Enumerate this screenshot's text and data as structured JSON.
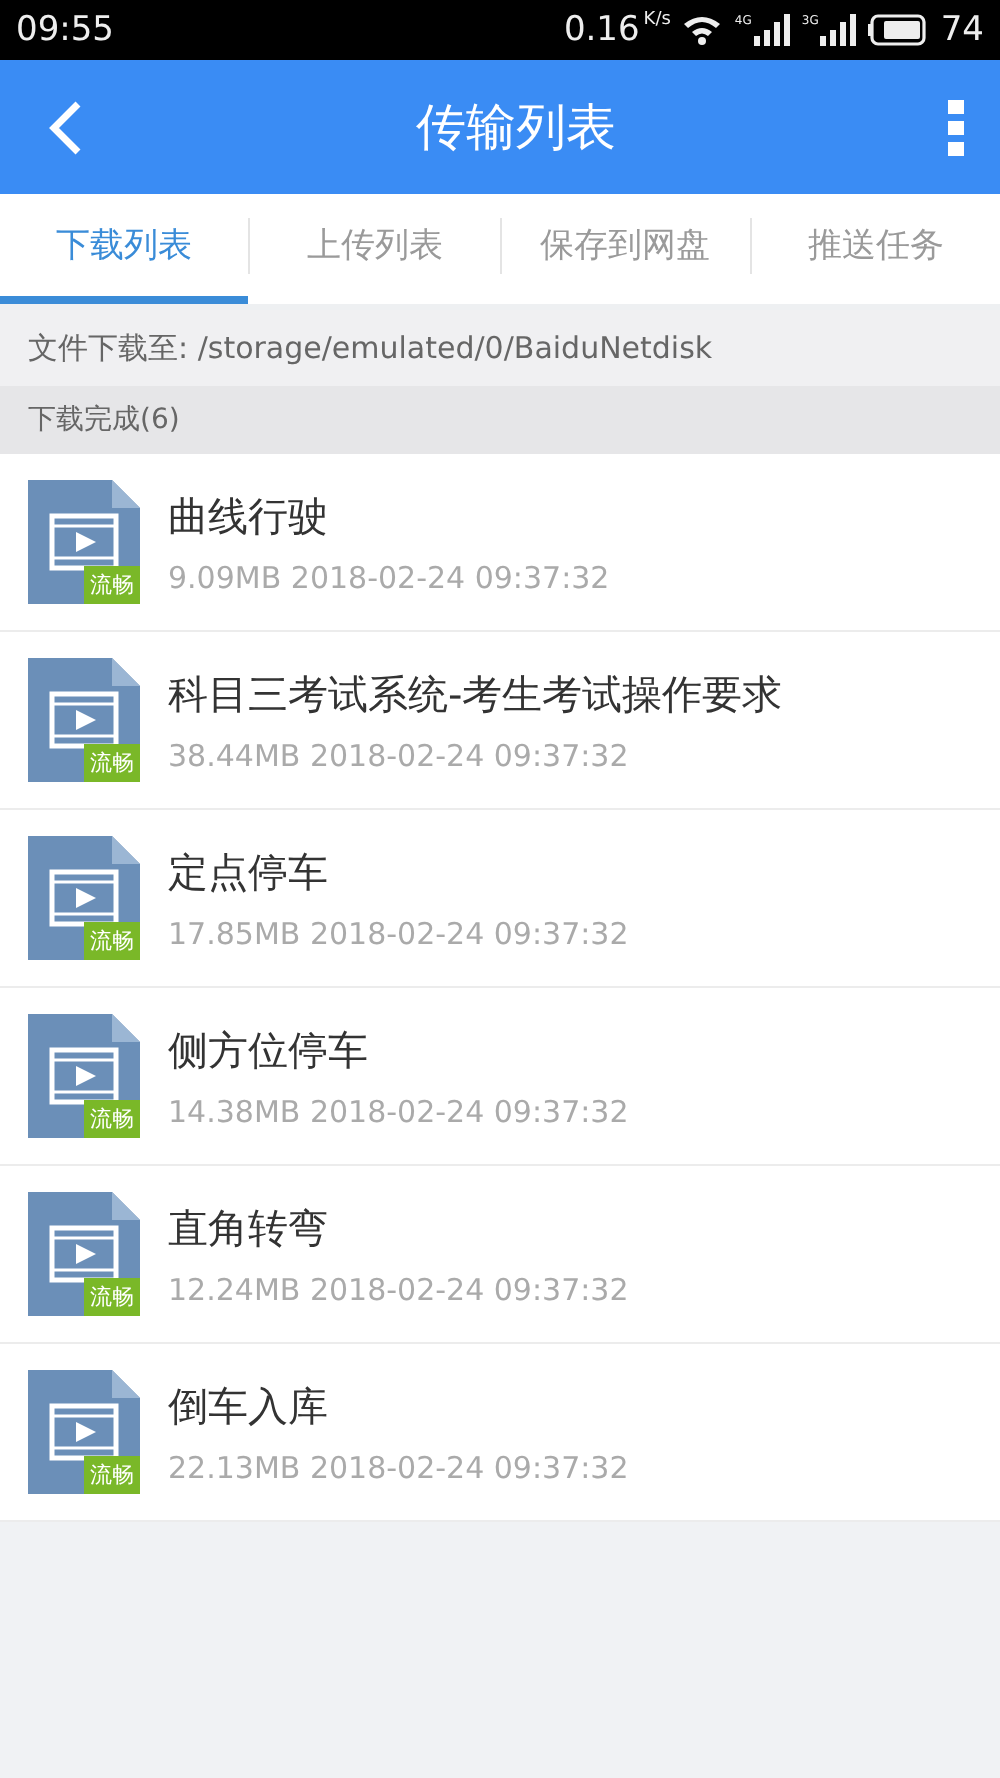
{
  "status_bar": {
    "time": "09:55",
    "speed": "0.16",
    "speed_unit": "K/s",
    "networks": [
      "4G",
      "3G"
    ],
    "battery": "74"
  },
  "header": {
    "title": "传输列表"
  },
  "tabs": [
    {
      "label": "下载列表",
      "selected": true
    },
    {
      "label": "上传列表",
      "selected": false
    },
    {
      "label": "保存到网盘",
      "selected": false
    },
    {
      "label": "推送任务",
      "selected": false
    }
  ],
  "path": "文件下载至: /storage/emulated/0/BaiduNetdisk",
  "section": "下载完成(6)",
  "files": [
    {
      "name": "曲线行驶",
      "badge": "流畅",
      "info": "9.09MB 2018-02-24 09:37:32"
    },
    {
      "name": "科目三考试系统-考生考试操作要求",
      "badge": "流畅",
      "info": "38.44MB 2018-02-24 09:37:32"
    },
    {
      "name": "定点停车",
      "badge": "流畅",
      "info": "17.85MB 2018-02-24 09:37:32"
    },
    {
      "name": "侧方位停车",
      "badge": "流畅",
      "info": "14.38MB 2018-02-24 09:37:32"
    },
    {
      "name": "直角转弯",
      "badge": "流畅",
      "info": "12.24MB 2018-02-24 09:37:32"
    },
    {
      "name": "倒车入库",
      "badge": "流畅",
      "info": "22.13MB 2018-02-24 09:37:32"
    }
  ]
}
